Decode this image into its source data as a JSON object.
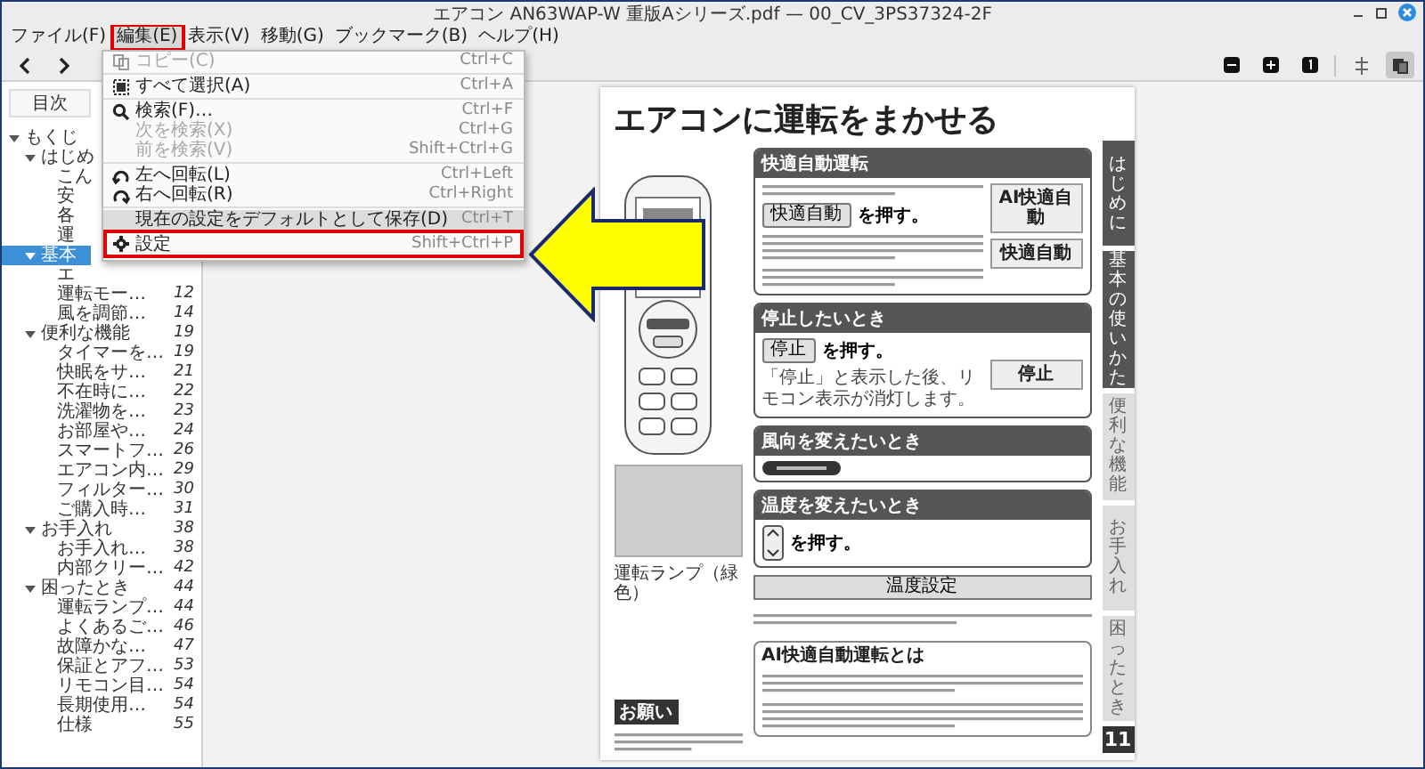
{
  "window": {
    "title": "エアコン AN63WAP-W 重版Aシリーズ.pdf — 00_CV_3PS37324-2F"
  },
  "menu_bar": [
    {
      "label": "ファイル(F)",
      "open": false,
      "annotated": false
    },
    {
      "label": "編集(E)",
      "open": true,
      "annotated": true
    },
    {
      "label": "表示(V)",
      "open": false,
      "annotated": false
    },
    {
      "label": "移動(G)",
      "open": false,
      "annotated": false
    },
    {
      "label": "ブックマーク(B)",
      "open": false,
      "annotated": false
    },
    {
      "label": "ヘルプ(H)",
      "open": false,
      "annotated": false
    }
  ],
  "edit_menu": [
    {
      "kind": "item",
      "label": "コピー(C)",
      "shortcut": "Ctrl+C",
      "disabled": true,
      "hovered": false,
      "annotated": false
    },
    {
      "kind": "separator"
    },
    {
      "kind": "item",
      "label": "すべて選択(A)",
      "shortcut": "Ctrl+A",
      "disabled": false,
      "hovered": false,
      "annotated": false
    },
    {
      "kind": "separator"
    },
    {
      "kind": "item",
      "label": "検索(F)…",
      "shortcut": "Ctrl+F",
      "disabled": false,
      "hovered": false,
      "annotated": false
    },
    {
      "kind": "item",
      "label": "次を検索(X)",
      "shortcut": "Ctrl+G",
      "disabled": true,
      "hovered": false,
      "annotated": false
    },
    {
      "kind": "item",
      "label": "前を検索(V)",
      "shortcut": "Shift+Ctrl+G",
      "disabled": true,
      "hovered": false,
      "annotated": false
    },
    {
      "kind": "separator"
    },
    {
      "kind": "item",
      "label": "左へ回転(L)",
      "shortcut": "Ctrl+Left",
      "disabled": false,
      "hovered": false,
      "annotated": false
    },
    {
      "kind": "item",
      "label": "右へ回転(R)",
      "shortcut": "Ctrl+Right",
      "disabled": false,
      "hovered": false,
      "annotated": false
    },
    {
      "kind": "separator"
    },
    {
      "kind": "item",
      "label": "現在の設定をデフォルトとして保存(D)",
      "shortcut": "Ctrl+T",
      "disabled": false,
      "hovered": true,
      "annotated": false
    },
    {
      "kind": "item",
      "label": "設定",
      "shortcut": "Shift+Ctrl+P",
      "disabled": false,
      "hovered": false,
      "annotated": true
    }
  ],
  "view_toggles": [
    {
      "selected": false
    },
    {
      "selected": true
    }
  ],
  "sidebar": {
    "tab": "目次",
    "items": [
      {
        "label": "もくじ",
        "expanded": true,
        "selected": false,
        "children": [
          {
            "label": "はじめ",
            "expanded": true,
            "selected": false,
            "children": [
              {
                "label": "こん",
                "selected": false
              },
              {
                "label": "安",
                "selected": false
              },
              {
                "label": "各",
                "selected": false
              },
              {
                "label": "運",
                "selected": false
              }
            ]
          },
          {
            "label": "基本",
            "expanded": true,
            "selected": true,
            "children": [
              {
                "label": "エ",
                "selected": false
              },
              {
                "label": "運転モー…",
                "page": "12",
                "selected": false
              },
              {
                "label": "風を調節…",
                "page": "14",
                "selected": false
              }
            ]
          },
          {
            "label": "便利な機能",
            "page": "19",
            "expanded": true,
            "selected": false,
            "children": [
              {
                "label": "タイマーを…",
                "page": "19",
                "selected": false
              },
              {
                "label": "快眠をサ…",
                "page": "21",
                "selected": false
              },
              {
                "label": "不在時に…",
                "page": "22",
                "selected": false
              },
              {
                "label": "洗濯物を…",
                "page": "23",
                "selected": false
              },
              {
                "label": "お部屋や…",
                "page": "24",
                "selected": false
              },
              {
                "label": "スマートフ…",
                "page": "26",
                "selected": false
              },
              {
                "label": "エアコン内…",
                "page": "29",
                "selected": false
              },
              {
                "label": "フィルター…",
                "page": "30",
                "selected": false
              },
              {
                "label": "ご購入時…",
                "page": "31",
                "selected": false
              }
            ]
          },
          {
            "label": "お手入れ",
            "page": "38",
            "expanded": true,
            "selected": false,
            "children": [
              {
                "label": "お手入れ…",
                "page": "38",
                "selected": false
              },
              {
                "label": "内部クリー…",
                "page": "42",
                "selected": false
              }
            ]
          },
          {
            "label": "困ったとき",
            "page": "44",
            "expanded": true,
            "selected": false,
            "children": [
              {
                "label": "運転ランプ…",
                "page": "44",
                "selected": false
              },
              {
                "label": "よくあるご…",
                "page": "46",
                "selected": false
              },
              {
                "label": "故障かな…",
                "page": "47",
                "selected": false
              },
              {
                "label": "保証とアフ…",
                "page": "53",
                "selected": false
              },
              {
                "label": "リモコン目…",
                "page": "54",
                "selected": false
              },
              {
                "label": "長期使用…",
                "page": "54",
                "selected": false
              },
              {
                "label": "仕様",
                "page": "55",
                "selected": false
              }
            ]
          }
        ]
      }
    ]
  },
  "document": {
    "heading": "エアコンに運転をまかせる",
    "sections": [
      {
        "kind": "auto",
        "title": "快適自動運転",
        "button": "快適自動",
        "action": "を押す。",
        "displays": [
          "AI快適自動",
          "快適自動"
        ]
      },
      {
        "kind": "stop",
        "title": "停止したいとき",
        "button": "停止",
        "action": "を押す。",
        "note": "「停止」と表示した後、リモコン表示が消灯します。",
        "display": "停止"
      },
      {
        "kind": "link",
        "title": "風向を変えたいとき"
      },
      {
        "kind": "updown",
        "title": "温度を変えたいとき",
        "action": "を押す。"
      },
      {
        "kind": "table",
        "title": "温度設定"
      },
      {
        "kind": "info",
        "title": "AI快適自動運転とは"
      }
    ],
    "caption": "運転ランプ（緑色）",
    "note_title": "お願い",
    "tabs": [
      {
        "label": "はじめに",
        "emphasized": true
      },
      {
        "label": "基本の使いかた",
        "emphasized": true
      },
      {
        "label": "便利な機能",
        "emphasized": false
      },
      {
        "label": "お手入れ",
        "emphasized": false
      },
      {
        "label": "困ったとき",
        "emphasized": false
      }
    ],
    "page_number": "11"
  }
}
